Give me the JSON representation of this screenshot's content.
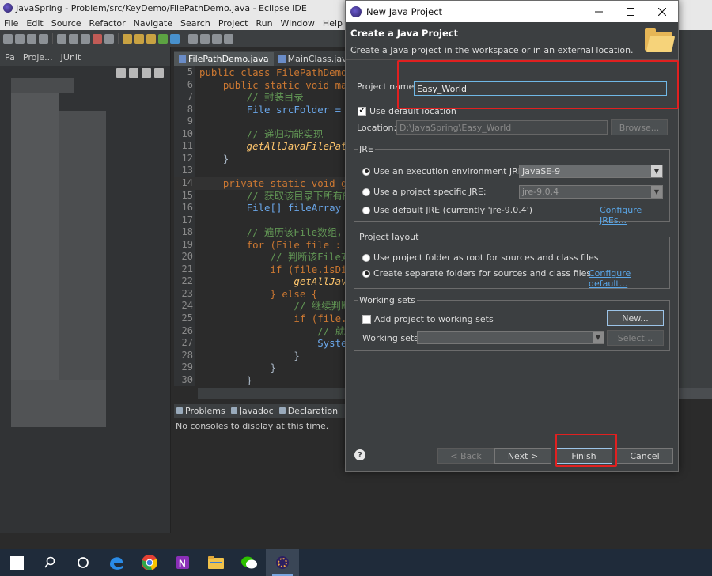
{
  "ide": {
    "window_title": "JavaSpring - Problem/src/KeyDemo/FilePathDemo.java - Eclipse IDE",
    "menu": [
      "File",
      "Edit",
      "Source",
      "Refactor",
      "Navigate",
      "Search",
      "Project",
      "Run",
      "Window",
      "Help"
    ],
    "left_tabs": [
      "Pa",
      "Proje...",
      "JUnit"
    ],
    "editor_tabs": [
      "FilePathDemo.java",
      "MainClass.java"
    ],
    "code_lines": [
      {
        "n": "5",
        "text": "public class FilePathDemo"
      },
      {
        "n": "6",
        "text": "    public static void ma"
      },
      {
        "n": "7",
        "text": "        // 封装目录"
      },
      {
        "n": "8",
        "text": "        File srcFolder ="
      },
      {
        "n": "9",
        "text": ""
      },
      {
        "n": "10",
        "text": "        // 递归功能实现"
      },
      {
        "n": "11",
        "text": "        getAllJavaFilePat"
      },
      {
        "n": "12",
        "text": "    }"
      },
      {
        "n": "13",
        "text": ""
      },
      {
        "n": "14",
        "text": "    private static void g"
      },
      {
        "n": "15",
        "text": "        // 获取该目录下所有的文"
      },
      {
        "n": "16",
        "text": "        File[] fileArray"
      },
      {
        "n": "17",
        "text": ""
      },
      {
        "n": "18",
        "text": "        // 遍历该File数组，得到"
      },
      {
        "n": "19",
        "text": "        for (File file :"
      },
      {
        "n": "20",
        "text": "            // 判断该File对象"
      },
      {
        "n": "21",
        "text": "            if (file.isDi"
      },
      {
        "n": "22",
        "text": "                getAllJav"
      },
      {
        "n": "23",
        "text": "            } else {"
      },
      {
        "n": "24",
        "text": "                // 继续判断"
      },
      {
        "n": "25",
        "text": "                if (file."
      },
      {
        "n": "26",
        "text": "                    // 就"
      },
      {
        "n": "27",
        "text": "                    Syste"
      },
      {
        "n": "28",
        "text": "                }"
      },
      {
        "n": "29",
        "text": "            }"
      },
      {
        "n": "30",
        "text": "        }"
      }
    ],
    "bottom_tabs": [
      "Problems",
      "Javadoc",
      "Declaration"
    ],
    "console_text": "No consoles to display at this time."
  },
  "dialog": {
    "title": "New Java Project",
    "header_title": "Create a Java Project",
    "header_desc": "Create a Java project in the workspace or in an external location.",
    "project_name_label": "Project name:",
    "project_name_value": "Easy_World",
    "use_default_location_label": "Use default location",
    "location_label": "Location:",
    "location_value": "D:\\JavaSpring\\Easy_World",
    "browse_label": "Browse...",
    "jre": {
      "legend": "JRE",
      "opt1_label": "Use an execution environment JRE:",
      "opt1_value": "JavaSE-9",
      "opt2_label": "Use a project specific JRE:",
      "opt2_value": "jre-9.0.4",
      "opt3_label": "Use default JRE (currently 'jre-9.0.4')",
      "configure_link": "Configure JREs..."
    },
    "layout": {
      "legend": "Project layout",
      "opt1_label": "Use project folder as root for sources and class files",
      "opt2_label": "Create separate folders for sources and class files",
      "configure_link": "Configure default..."
    },
    "working_sets": {
      "legend": "Working sets",
      "add_label": "Add project to working sets",
      "new_label": "New...",
      "sets_label": "Working sets:",
      "select_label": "Select..."
    },
    "buttons": {
      "back": "< Back",
      "next": "Next >",
      "finish": "Finish",
      "cancel": "Cancel"
    }
  },
  "colors": {
    "highlight": "#e02020",
    "link": "#5aa7e8"
  }
}
